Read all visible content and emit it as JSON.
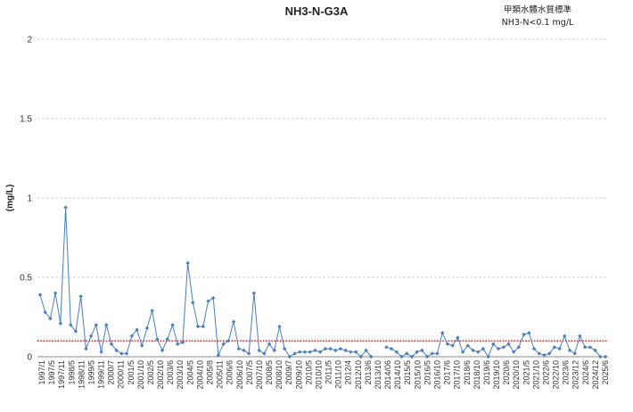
{
  "chart_data": {
    "type": "line",
    "title": "NH3-N-G3A",
    "ylabel": "(mg/L)",
    "xlabel": "",
    "ylim": [
      0,
      2
    ],
    "yticks": [
      "0",
      "0.5",
      "1",
      "1.5",
      "2"
    ],
    "grid": true,
    "legend": "none",
    "annotation": {
      "line1": "甲類水體水質標準",
      "line2": "NH3-N<0.1 mg/L"
    },
    "standard": {
      "value": 0.1,
      "color": "#d62728",
      "style": "dotted"
    },
    "series_color": "#4a7ebb",
    "x_tick_labels": [
      "1997/1",
      "1997/5",
      "1997/11",
      "1998/5",
      "1998/11",
      "1999/5",
      "1999/11",
      "2000/7",
      "2000/11",
      "2001/5",
      "2001/10",
      "2002/5",
      "2002/10",
      "2003/6",
      "2003/10",
      "2004/5",
      "2004/10",
      "2005/8",
      "2005/11",
      "2006/6",
      "2006/10",
      "2007/5",
      "2007/10",
      "2008/5",
      "2008/10",
      "2009/7",
      "2009/10",
      "2010/5",
      "2010/10",
      "2011/5",
      "2011/10",
      "2012/4",
      "2012/10",
      "2013/6",
      "2013/10",
      "2014/06",
      "2014/10",
      "2015/5",
      "2015/10",
      "2016/5",
      "2016/10",
      "2017/6",
      "2017/10",
      "2018/6",
      "2018/10",
      "2019/6",
      "2019/10",
      "2020/6",
      "2020/10",
      "2021/5",
      "2021/10",
      "2022/6",
      "2022/10",
      "2023/6",
      "2023/12",
      "2024/6",
      "2024/12",
      "2025/6"
    ],
    "series": [
      {
        "values": [
          0.39,
          0.28,
          0.24,
          0.4,
          0.21,
          0.94,
          0.2,
          0.16,
          0.38,
          0.05,
          0.13,
          0.2,
          0.03,
          0.2,
          0.08,
          0.04,
          0.02,
          0.02,
          0.13,
          0.17,
          0.07,
          0.18,
          0.29,
          0.11,
          0.04,
          0.11,
          0.2,
          0.08,
          0.09,
          0.59,
          0.34,
          0.19,
          0.19,
          0.35,
          0.37,
          0.01,
          0.08,
          0.1,
          0.22,
          0.05,
          0.04,
          0.02,
          0.4,
          0.04,
          0.02,
          0.08,
          0.04,
          0.19,
          0.05,
          0.0,
          0.02,
          0.03,
          0.03,
          0.03,
          0.04,
          0.03,
          0.05,
          0.05,
          0.04,
          0.05,
          0.04,
          0.03,
          0.03,
          0.0,
          0.04,
          0.0,
          null,
          null,
          0.06,
          0.05,
          0.03,
          0.0,
          0.02,
          0.0,
          0.03,
          0.04,
          0.0,
          0.02,
          0.02,
          0.15,
          0.08,
          0.07,
          0.12,
          0.03,
          0.07,
          0.04,
          0.03,
          0.05,
          0.0,
          0.08,
          0.05,
          0.06,
          0.08,
          0.03,
          0.06,
          0.14,
          0.15,
          0.05,
          0.02,
          0.01,
          0.02,
          0.06,
          0.05,
          0.13,
          0.04,
          0.02,
          0.13,
          0.06,
          0.06,
          0.04,
          0.0,
          0.0
        ]
      }
    ]
  }
}
